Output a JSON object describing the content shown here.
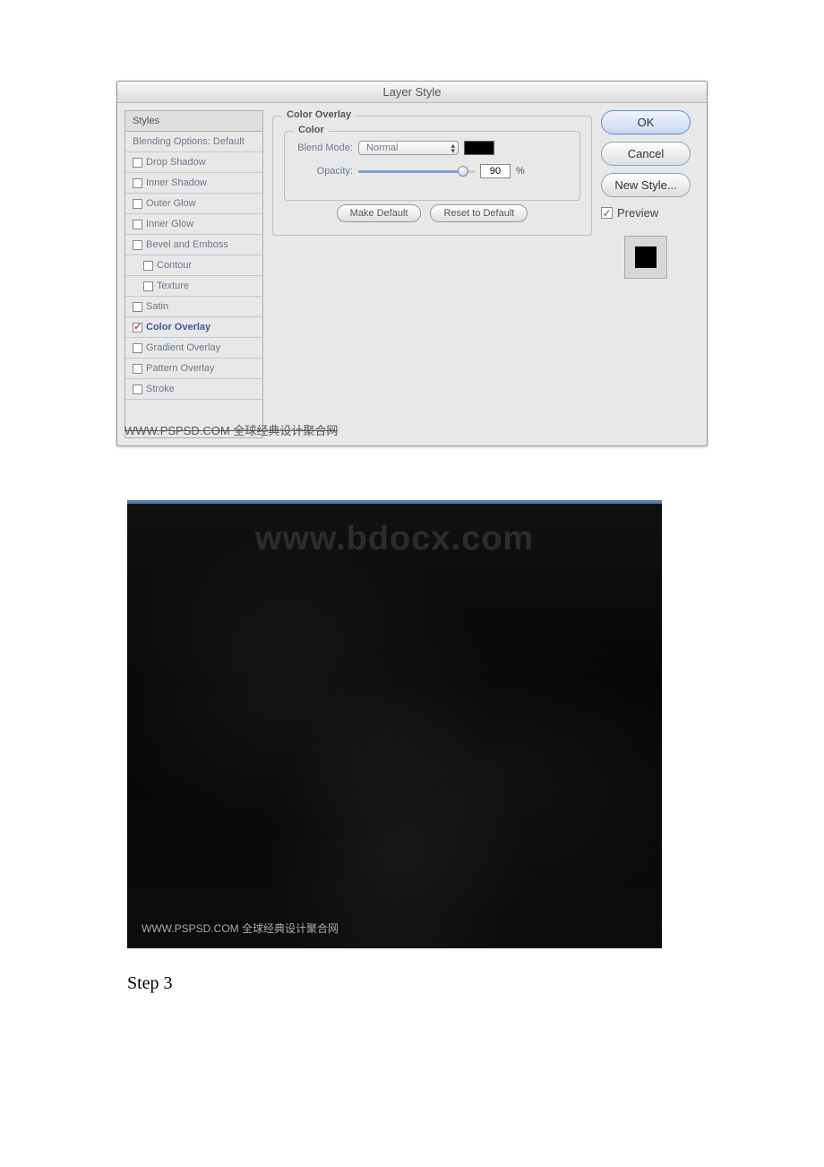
{
  "dialog": {
    "title": "Layer Style",
    "styles_header": "Styles",
    "styles": [
      {
        "label": "Blending Options: Default",
        "checkbox": false,
        "checked": false,
        "selected": false,
        "indent": false
      },
      {
        "label": "Drop Shadow",
        "checkbox": true,
        "checked": false,
        "selected": false,
        "indent": false
      },
      {
        "label": "Inner Shadow",
        "checkbox": true,
        "checked": false,
        "selected": false,
        "indent": false
      },
      {
        "label": "Outer Glow",
        "checkbox": true,
        "checked": false,
        "selected": false,
        "indent": false
      },
      {
        "label": "Inner Glow",
        "checkbox": true,
        "checked": false,
        "selected": false,
        "indent": false
      },
      {
        "label": "Bevel and Emboss",
        "checkbox": true,
        "checked": false,
        "selected": false,
        "indent": false
      },
      {
        "label": "Contour",
        "checkbox": true,
        "checked": false,
        "selected": false,
        "indent": true
      },
      {
        "label": "Texture",
        "checkbox": true,
        "checked": false,
        "selected": false,
        "indent": true
      },
      {
        "label": "Satin",
        "checkbox": true,
        "checked": false,
        "selected": false,
        "indent": false
      },
      {
        "label": "Color Overlay",
        "checkbox": true,
        "checked": true,
        "selected": true,
        "indent": false
      },
      {
        "label": "Gradient Overlay",
        "checkbox": true,
        "checked": false,
        "selected": false,
        "indent": false
      },
      {
        "label": "Pattern Overlay",
        "checkbox": true,
        "checked": false,
        "selected": false,
        "indent": false
      },
      {
        "label": "Stroke",
        "checkbox": true,
        "checked": false,
        "selected": false,
        "indent": false
      }
    ],
    "fieldset_outer": "Color Overlay",
    "fieldset_inner": "Color",
    "blend_mode_label": "Blend Mode:",
    "blend_mode_value": "Normal",
    "opacity_label": "Opacity:",
    "opacity_value": "90",
    "opacity_unit": "%",
    "make_default": "Make Default",
    "reset_default": "Reset to Default",
    "ok": "OK",
    "cancel": "Cancel",
    "new_style": "New Style...",
    "preview": "Preview",
    "watermark": "WWW.PSPSD.COM 全球经典设计聚合网",
    "overlay_color": "#000000"
  },
  "preview": {
    "watermark": "www.bdocx.com",
    "bottom_text": "WWW.PSPSD.COM 全球经典设计聚合网"
  },
  "step": "Step 3"
}
